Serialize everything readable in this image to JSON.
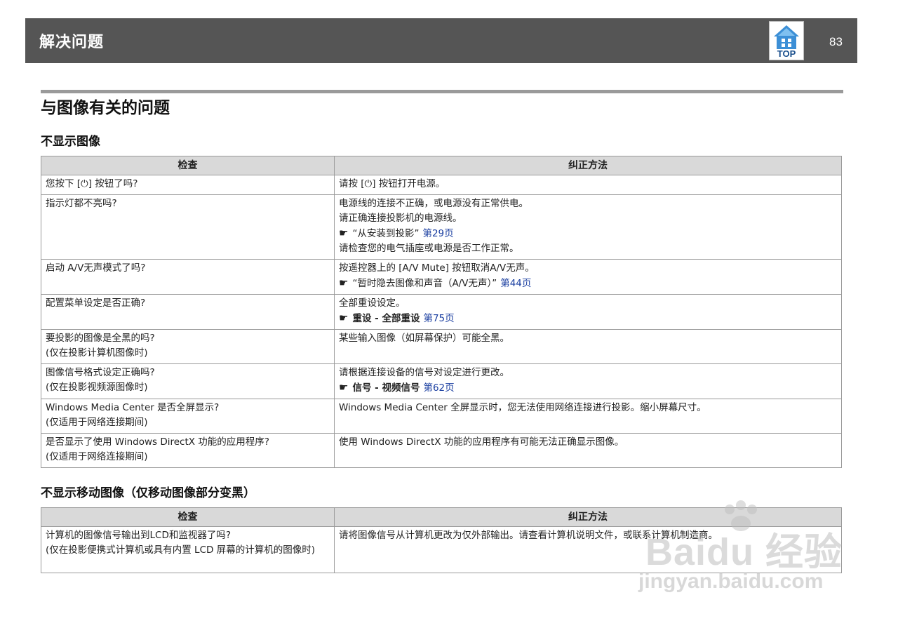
{
  "header": {
    "title": "解决问题",
    "top_label": "TOP",
    "page_number": "83"
  },
  "section_title": "与图像有关的问题",
  "tables": [
    {
      "subheading": "不显示图像",
      "columns": [
        "检查",
        "纠正方法"
      ],
      "rows": [
        {
          "check": [
            "您按下 [⏻] 按钮了吗?"
          ],
          "fix": [
            "请按 [⏻] 按钮打开电源。"
          ]
        },
        {
          "check": [
            "指示灯都不亮吗?"
          ],
          "fix": [
            "电源线的连接不正确，或电源没有正常供电。",
            "请正确连接投影机的电源线。"
          ],
          "ref": {
            "text": "“从安装到投影”",
            "link": "第29页"
          },
          "fix_after": [
            "请检查您的电气插座或电源是否工作正常。"
          ]
        },
        {
          "check": [
            "启动 A/V无声模式了吗?"
          ],
          "fix": [
            "按遥控器上的 [A/V Mute] 按钮取消A/V无声。"
          ],
          "ref": {
            "text": "“暂时隐去图像和声音（A/V无声）”",
            "link": "第44页"
          }
        },
        {
          "check": [
            "配置菜单设定是否正确?"
          ],
          "fix": [
            "全部重设设定。"
          ],
          "ref": {
            "text": "重设 - 全部重设",
            "link": "第75页",
            "bold": true
          }
        },
        {
          "check": [
            "要投影的图像是全黑的吗?",
            "(仅在投影计算机图像时)"
          ],
          "fix": [
            "某些输入图像（如屏幕保护）可能全黑。"
          ]
        },
        {
          "check": [
            "图像信号格式设定正确吗?",
            "(仅在投影视频源图像时)"
          ],
          "fix": [
            "请根据连接设备的信号对设定进行更改。"
          ],
          "ref": {
            "text": "信号 - 视频信号",
            "link": "第62页",
            "bold": true
          }
        },
        {
          "check": [
            "Windows Media Center 是否全屏显示?",
            "(仅适用于网络连接期间)"
          ],
          "fix": [
            "Windows Media Center 全屏显示时，您无法使用网络连接进行投影。缩小屏幕尺寸。"
          ]
        },
        {
          "check": [
            "是否显示了使用 Windows DirectX 功能的应用程序?",
            "(仅适用于网络连接期间)"
          ],
          "fix": [
            "使用 Windows DirectX 功能的应用程序有可能无法正确显示图像。"
          ]
        }
      ]
    },
    {
      "subheading": "不显示移动图像（仅移动图像部分变黑）",
      "columns": [
        "检查",
        "纠正方法"
      ],
      "rows": [
        {
          "check": [
            "计算机的图像信号输出到LCD和监视器了吗?",
            "(仅在投影便携式计算机或具有内置 LCD 屏幕的计算机的图像时)"
          ],
          "fix": [
            "请将图像信号从计算机更改为仅外部输出。请查看计算机说明文件，或联系计算机制造商。"
          ]
        }
      ]
    }
  ],
  "watermark": {
    "main": "Baidu 经验",
    "sub": "jingyan.baidu.com"
  }
}
